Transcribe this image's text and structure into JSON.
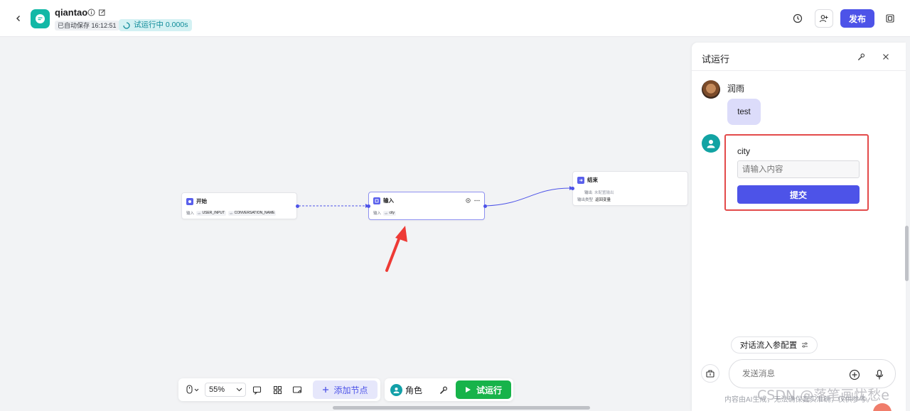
{
  "header": {
    "app_name": "qiantao",
    "autosave": "已自动保存 16:12:51",
    "run_status": "试运行中 0.000s",
    "publish_label": "发布",
    "icons": [
      "back-icon",
      "app-logo-icon",
      "info-icon",
      "edit-icon",
      "history-icon",
      "collaborator-icon",
      "layout-icon"
    ]
  },
  "nodes": {
    "start": {
      "title": "开始",
      "row_label": "输入",
      "tags": [
        "USER_INPUT",
        "CONVERSATION_NAME"
      ]
    },
    "input": {
      "title": "输入",
      "row_label": "输入",
      "tags": [
        "city"
      ]
    },
    "end": {
      "title": "结束",
      "row1_label": "输出",
      "row1_value": "未配置输出",
      "row2_label": "输出类型",
      "row2_value": "返回变量"
    }
  },
  "toolbar": {
    "zoom": "55%",
    "add_node_label": "添加节点",
    "role_label": "角色",
    "run_label": "试运行"
  },
  "panel": {
    "title": "试运行",
    "user_name": "润雨",
    "user_message": "test",
    "form": {
      "field_label": "city",
      "placeholder": "请输入内容",
      "submit_label": "提交"
    },
    "config_chip_label": "对话流入参配置",
    "message_placeholder": "发送消息",
    "disclaimer": "内容由AI生成，无法确保真实准确，仅供参考。"
  },
  "watermark": "CSDN @落笔画忧愁e",
  "colors": {
    "brand": "#4d53e8",
    "run_green": "#17b34a",
    "teal": "#13b8a6",
    "highlight_red": "#e34a4a"
  }
}
